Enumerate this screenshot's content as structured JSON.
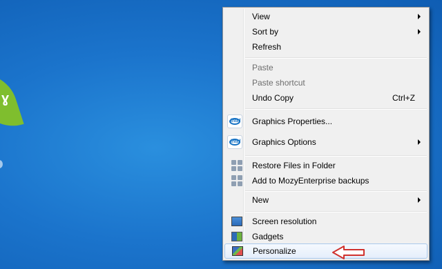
{
  "menu": {
    "items": [
      {
        "label": "View",
        "submenu": true
      },
      {
        "label": "Sort by",
        "submenu": true
      },
      {
        "label": "Refresh"
      },
      {
        "label": "Paste",
        "disabled": true
      },
      {
        "label": "Paste shortcut",
        "disabled": true
      },
      {
        "label": "Undo Copy",
        "shortcut": "Ctrl+Z"
      },
      {
        "label": "Graphics Properties...",
        "icon": "intel-icon"
      },
      {
        "label": "Graphics Options",
        "icon": "intel-icon",
        "submenu": true
      },
      {
        "label": "Restore Files in Folder",
        "icon": "mozy-icon"
      },
      {
        "label": "Add to MozyEnterprise backups",
        "icon": "mozy-icon"
      },
      {
        "label": "New",
        "submenu": true
      },
      {
        "label": "Screen resolution",
        "icon": "screen-resolution-icon"
      },
      {
        "label": "Gadgets",
        "icon": "gadgets-icon"
      },
      {
        "label": "Personalize",
        "icon": "personalize-icon",
        "highlighted": true
      }
    ],
    "intel_logo_text": "intel"
  },
  "annotation": {
    "icon": "red-arrow-icon",
    "color": "#d0312d"
  },
  "colors": {
    "desktop": "#1b74cc",
    "menu_bg": "#f0f0f0",
    "disabled_text": "#6d6d6d",
    "hover_border": "#a8c8ec"
  }
}
